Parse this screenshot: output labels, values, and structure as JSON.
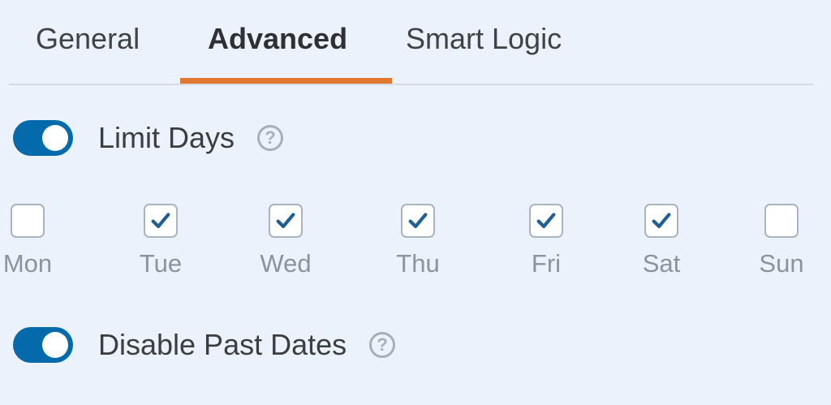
{
  "tabs": [
    {
      "label": "General",
      "active": false
    },
    {
      "label": "Advanced",
      "active": true
    },
    {
      "label": "Smart Logic",
      "active": false
    }
  ],
  "limit_days": {
    "label": "Limit Days",
    "enabled": true,
    "help_icon": "help-icon"
  },
  "days": [
    {
      "label": "Mon",
      "checked": false
    },
    {
      "label": "Tue",
      "checked": true
    },
    {
      "label": "Wed",
      "checked": true
    },
    {
      "label": "Thu",
      "checked": true
    },
    {
      "label": "Fri",
      "checked": true
    },
    {
      "label": "Sat",
      "checked": true
    },
    {
      "label": "Sun",
      "checked": false
    }
  ],
  "disable_past_dates": {
    "label": "Disable Past Dates",
    "enabled": true,
    "help_icon": "help-icon"
  },
  "colors": {
    "background": "#ebf2fb",
    "toggle_on": "#056aab",
    "tab_active_underline": "#e27730",
    "check_mark": "#1f5f96"
  }
}
